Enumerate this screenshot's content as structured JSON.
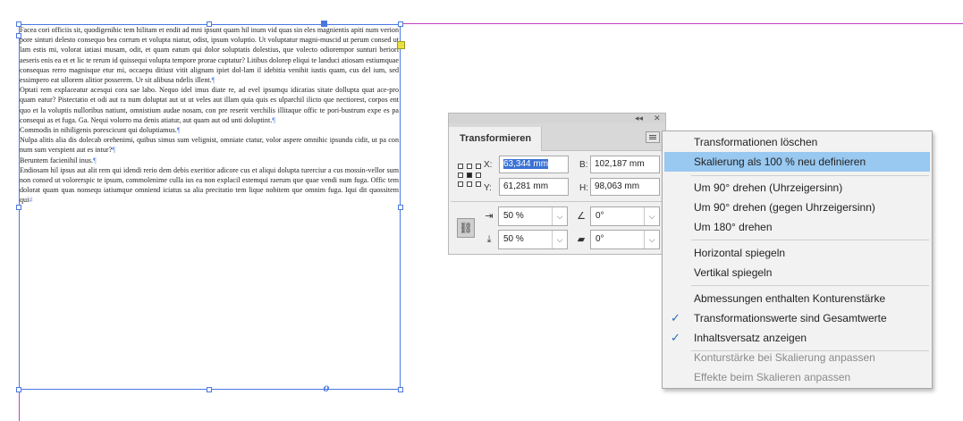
{
  "document": {
    "story": [
      "Facea cori officiis sit, quodigenihic tem hilitam et endit ad mni ipsunt quam hil inum vid quas sin eles magnientis apiti num verion pore sinturi delesto consequo bea corrum et volupta niatur, odist, ipsum voluptio. Ut voluptatur magni-muscid ut perum consed ut lam estis mi, volorat iatiasi musam, odit, et quam eatum qui dolor soluptatis dolestius, que volecto odiorempor sunturi beriori aeseris enis ea et et lic te rerum id quissequi volupta tempore prorae cuptatur? Litibus dolorep eliqui te landuci atiosam estiumquae consequas rerro magnisque etur mi, occaepu ditiust vitit alignam ipiet dol-lam il idebitia venihit iustis quam, cus del ium, sed essimpero eat ullorem alitior posserem. Ur sit alibusa ndelis illent.",
      "Optati rem explaceatur acesqui cora sae labo. Nequo idel imus diate re, ad evel ipsumqu idicatias sitate dollupta quat ace-pro quam eatur? Pistectatio et odi aut ra num doluptat aut ut ut veles aut illam quia quis es ulparchil ilicto que nectiorest, corpos ent quo et la voluptis nulloribus natiunt, omnistium audae nosam, con pre reserit verchilis illitaque offic te pori-bustrum expe es pa consequi as et fuga. Ga. Nequi volorro ma denis atiatur, aut quam aut od unti doluptint.",
      "Commodis in nihiligenis porescicunt qui doluptiamus.",
      "Nulpa alitis alia dis dolecab orehenimi, quibus simus sum velignist, omniate ctatur, volor aspere omnihic ipsundu cidit, ut pa con num sum verspient aut es intur?",
      "Beruntem facienihil inus.",
      "Endiosam hil ipsus aut alit rem qui idendi rerio dem debis exeritior adicore cus et aliqui dolupta turerciur a cus mossin-vellor sum non consed ut volorerspic te ipsum, commolenime culla ius ea non explacil estemqui raerum que quae vendi num fuga. Offic tem dolorat quam quas nonsequ iatiumque omniend iciatus sa alia precitatio tem lique nobitem que omnim fuga. Iqui dit quossitem qui"
    ],
    "pilcrow": "¶",
    "end_mark": "#",
    "outport_glyph": "o"
  },
  "panel": {
    "title": "Transformieren",
    "collapse_glyph": "◂◂",
    "close_glyph": "✕",
    "x_label": "X:",
    "x_value": "63,344 mm",
    "y_label": "Y:",
    "y_value": "61,281 mm",
    "b_label": "B:",
    "b_value": "102,187 mm",
    "h_label": "H:",
    "h_value": "98,063 mm",
    "scale_x_value": "50 %",
    "scale_y_value": "50 %",
    "rotate_value": "0°",
    "shear_value": "0°",
    "chain_glyph": "⛓"
  },
  "menu": {
    "items": [
      {
        "label": "Transformationen löschen",
        "highlighted": false,
        "checked": false,
        "disabled": false
      },
      {
        "label": "Skalierung als 100 % neu definieren",
        "highlighted": true,
        "checked": false,
        "disabled": false
      },
      {
        "label": "Um 90° drehen (Uhrzeigersinn)",
        "highlighted": false,
        "checked": false,
        "disabled": false
      },
      {
        "label": "Um 90° drehen (gegen Uhrzeigersinn)",
        "highlighted": false,
        "checked": false,
        "disabled": false
      },
      {
        "label": "Um 180° drehen",
        "highlighted": false,
        "checked": false,
        "disabled": false
      },
      {
        "label": "Horizontal spiegeln",
        "highlighted": false,
        "checked": false,
        "disabled": false
      },
      {
        "label": "Vertikal spiegeln",
        "highlighted": false,
        "checked": false,
        "disabled": false
      },
      {
        "label": "Abmessungen enthalten Konturenstärke",
        "highlighted": false,
        "checked": false,
        "disabled": false
      },
      {
        "label": "Transformationswerte sind Gesamtwerte",
        "highlighted": false,
        "checked": true,
        "disabled": false
      },
      {
        "label": "Inhaltsversatz anzeigen",
        "highlighted": false,
        "checked": true,
        "disabled": false
      },
      {
        "label": "Konturstärke bei Skalierung anpassen",
        "highlighted": false,
        "checked": false,
        "disabled": true
      },
      {
        "label": "Effekte beim Skalieren anpassen",
        "highlighted": false,
        "checked": false,
        "disabled": true
      }
    ],
    "check_glyph": "✓"
  },
  "colors": {
    "selection": "#4a78e0",
    "guide": "#c040c0",
    "menu_highlight": "#99c8f0",
    "check": "#2a6db5"
  }
}
